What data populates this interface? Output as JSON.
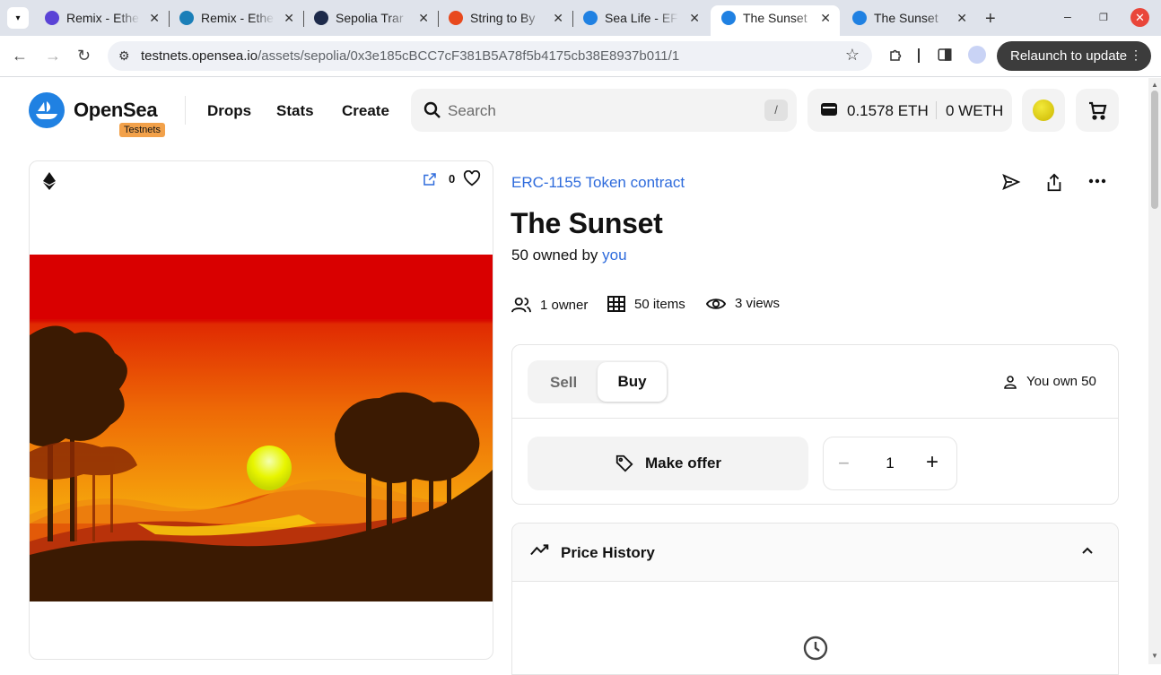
{
  "browser": {
    "tabs": [
      {
        "title": "Remix - Ethe",
        "favicon_color": "#5a43d6",
        "active": false
      },
      {
        "title": "Remix - Ethe",
        "favicon_color": "#1b7fb8",
        "active": false
      },
      {
        "title": "Sepolia Trar",
        "favicon_color": "#1d2a4a",
        "active": false
      },
      {
        "title": "String to By",
        "favicon_color": "#e8491d",
        "active": false
      },
      {
        "title": "Sea Life - EF",
        "favicon_color": "#2081e2",
        "active": false
      },
      {
        "title": "The Sunset",
        "favicon_color": "#2081e2",
        "active": true
      },
      {
        "title": "The Sunset",
        "favicon_color": "#2081e2",
        "active": false
      }
    ],
    "url_host": "testnets.opensea.io",
    "url_path": "/assets/sepolia/0x3e185cBCC7cF381B5A78f5b4175cb38E8937b011/1",
    "relaunch_label": "Relaunch to update"
  },
  "header": {
    "brand": "OpenSea",
    "badge": "Testnets",
    "nav": [
      "Drops",
      "Stats",
      "Create"
    ],
    "search_placeholder": "Search",
    "search_shortcut": "/",
    "eth_balance": "0.1578 ETH",
    "weth_balance": "0 WETH"
  },
  "media": {
    "favorite_count": "0"
  },
  "asset": {
    "collection": "ERC-1155 Token contract",
    "title": "The Sunset",
    "owned_prefix": "50 owned by",
    "owned_by": "you",
    "stats": {
      "owners": "1 owner",
      "items": "50 items",
      "views": "3 views"
    }
  },
  "trade": {
    "tab_sell": "Sell",
    "tab_buy": "Buy",
    "selected_tab": "Buy",
    "you_own": "You own 50",
    "make_offer": "Make offer",
    "quantity": "1",
    "minus": "−",
    "plus": "+"
  },
  "price_history": {
    "title": "Price History"
  },
  "colors": {
    "accent": "#2081e2",
    "link": "#2e6bdc",
    "badge": "#f2a14a"
  }
}
